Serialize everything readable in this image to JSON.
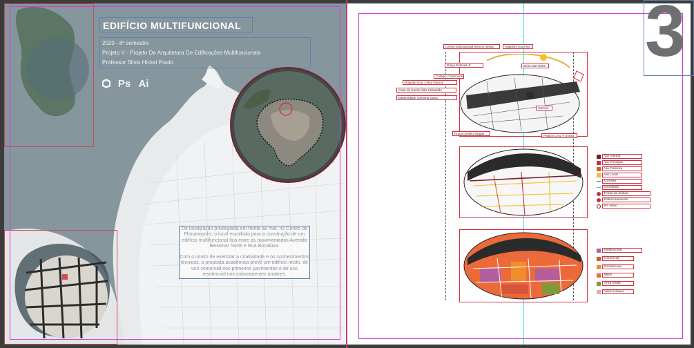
{
  "header": {
    "title": "EDIFÍCIO MULTIFUNCIONAL",
    "semester": "2020 - 6º semestre",
    "project": "Projeto V - Projeto De Arquitetura De Edificações Multifuncionais",
    "professor": "Professor Silvio Hickel Prado"
  },
  "software_icons": [
    {
      "name": "sketchup-icon",
      "label": ""
    },
    {
      "name": "photoshop-icon",
      "label": "Ps"
    },
    {
      "name": "illustrator-icon",
      "label": "Ai"
    }
  ],
  "description": {
    "paragraph1": "De localização privilegiada em frente ao mar, no Centro de Florianópolis, o local escolhido para a construção de um edifício multifuncional fica entre as movimentadas Avenida Beiramar Norte e Rua Bocaiúva.",
    "paragraph2": "Com o intuito de exercitar a criatividade e os conhecimentos técnicos, a proposta acadêmica prevê um edifício misto, de uso comercial nos primeiros pavimentos e de uso residencial nos subsequentes andares."
  },
  "page_number": "3",
  "landmark_labels": [
    "Centro Educacional Menino Jesus",
    "Angeloni Gourmet",
    "Praça Esteves Jr.",
    "Colégio Catarinense",
    "Hospital Gov. Celso Ramos",
    "Casa de Saúde São Sebastião",
    "Maternidade Carmela Dutra",
    "Praça Getúlio Vargas",
    "Beira Mar Norte",
    "Terreno",
    "Palácio Cruz e Sousa"
  ],
  "road_legend": [
    {
      "label": "Via Arterial",
      "color": "#7a1b2a"
    },
    {
      "label": "Via Principal",
      "color": "#c2314a"
    },
    {
      "label": "Via Coletora",
      "color": "#d15f2b"
    },
    {
      "label": "Via Local",
      "color": "#f2c02c"
    },
    {
      "label": "Ciclovia",
      "color": "#5bb0d6"
    },
    {
      "label": "Ciclofaixa",
      "color": "#5bb0d6"
    },
    {
      "label": "Ponto de ônibus",
      "color": "#c2314a"
    },
    {
      "label": "Estacionamento",
      "color": "#c2314a"
    },
    {
      "label": "Nó viário",
      "color": "#7a1b2a"
    }
  ],
  "use_legend": [
    {
      "label": "Institucional",
      "color": "#b35f9c"
    },
    {
      "label": "Comercial",
      "color": "#d8553c"
    },
    {
      "label": "Residencial",
      "color": "#f08d2c"
    },
    {
      "label": "Misto",
      "color": "#ec6a3a"
    },
    {
      "label": "Área Verde",
      "color": "#7f9a3a"
    },
    {
      "label": "Vazio Urbano",
      "color": "#f2a6b5"
    }
  ]
}
